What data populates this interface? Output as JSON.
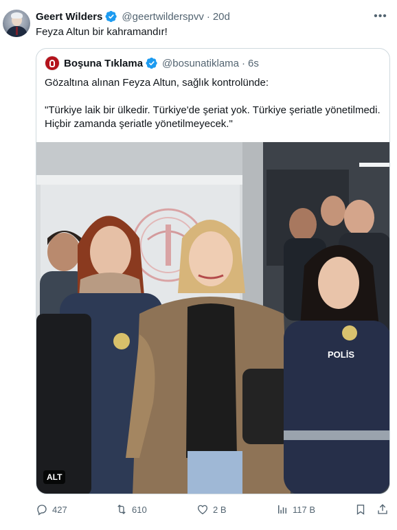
{
  "tweet": {
    "author_name": "Geert Wilders",
    "author_handle": "@geertwilderspvv",
    "separator": "·",
    "time": "20d",
    "text": "Feyza Altun bir kahramandır!",
    "more_label": "•••"
  },
  "quote": {
    "author_name": "Boşuna Tıklama",
    "author_handle": "@bosunatiklama",
    "separator": "·",
    "time": "6s",
    "line1": "Gözaltına alınan Feyza Altun, sağlık kontrolünde:",
    "line2": "\"Türkiye laik bir ülkedir. Türkiye'de şeriat yok. Türkiye şeriatle yönetilmedi. Hiçbir zamanda şeriatle yönetilmeyecek.\"",
    "alt_badge": "ALT",
    "photo_text": "POLİS"
  },
  "actions": {
    "replies": "427",
    "retweets": "610",
    "likes": "2 B",
    "views": "117 B"
  },
  "colors": {
    "verified": "#1d9bf0",
    "muted": "#536471",
    "text": "#0f1419",
    "border": "#cfd9de"
  },
  "icons": [
    "more-icon",
    "verified-badge-icon",
    "reply-icon",
    "retweet-icon",
    "like-icon",
    "views-icon",
    "bookmark-icon",
    "share-icon"
  ]
}
